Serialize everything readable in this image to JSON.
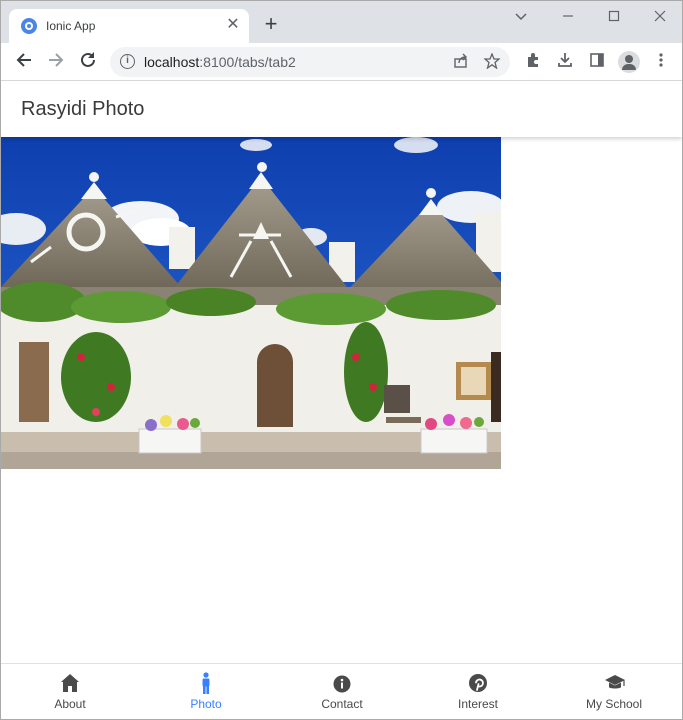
{
  "browser": {
    "tab_title": "Ionic App",
    "close_glyph": "✕",
    "new_tab_glyph": "+",
    "url_host": "localhost",
    "url_rest": ":8100/tabs/tab2"
  },
  "app": {
    "title": "Rasyidi Photo"
  },
  "tabs": [
    {
      "label": "About",
      "icon": "home-icon",
      "active": false
    },
    {
      "label": "Photo",
      "icon": "person-icon",
      "active": true
    },
    {
      "label": "Contact",
      "icon": "info-icon",
      "active": false
    },
    {
      "label": "Interest",
      "icon": "pinterest-icon",
      "active": false
    },
    {
      "label": "My School",
      "icon": "school-icon",
      "active": false
    }
  ],
  "colors": {
    "accent": "#3880ff",
    "tab_inactive": "#4a4a4a"
  }
}
